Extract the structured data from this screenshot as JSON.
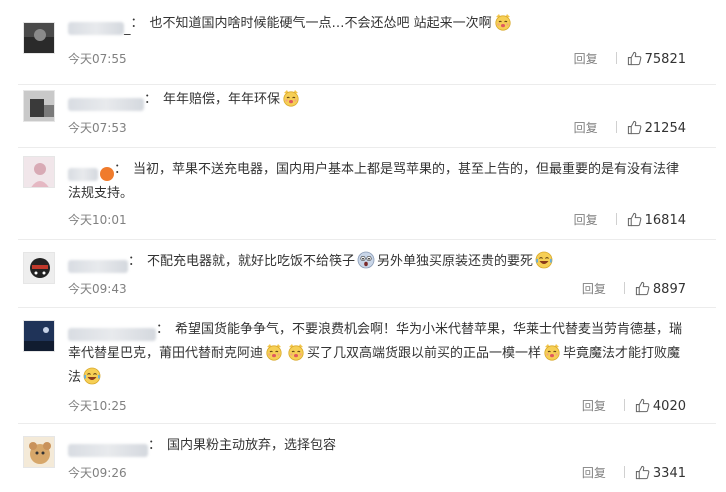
{
  "labels": {
    "reply": "回复"
  },
  "comments": [
    {
      "username_end": "_",
      "text_parts": [
        "也不知道国内啥时候能硬气一点…不会还怂吧 站起来一次啊"
      ],
      "time": "今天07:55",
      "likes": "75821"
    },
    {
      "username_end": "",
      "text_parts": [
        "年年赔偿，年年环保"
      ],
      "time": "今天07:53",
      "likes": "21254"
    },
    {
      "username_end": "",
      "text_parts": [
        "当初，苹果不送充电器，国内用户基本上都是骂苹果的，甚至上告的，但最重要的是有没有法律法规支持。"
      ],
      "time": "今天10:01",
      "likes": "16814"
    },
    {
      "username_end": "",
      "text_parts": [
        "不配充电器就，就好比吃饭不给筷子",
        "另外单独买原装还贵的要死"
      ],
      "time": "今天09:43",
      "likes": "8897"
    },
    {
      "username_end": "",
      "text_parts": [
        "希望国货能争争气，不要浪费机会啊！华为小米代替苹果，华莱士代替麦当劳肯德基，瑞幸代替星巴克，莆田代替耐克阿迪",
        "买了几双高端货跟以前买的正品一模一样",
        "毕竟魔法才能打败魔法"
      ],
      "time": "今天10:25",
      "likes": "4020"
    },
    {
      "username_end": "",
      "text_parts": [
        "国内果粉主动放弃，选择包容"
      ],
      "time": "今天09:26",
      "likes": "3341"
    }
  ]
}
